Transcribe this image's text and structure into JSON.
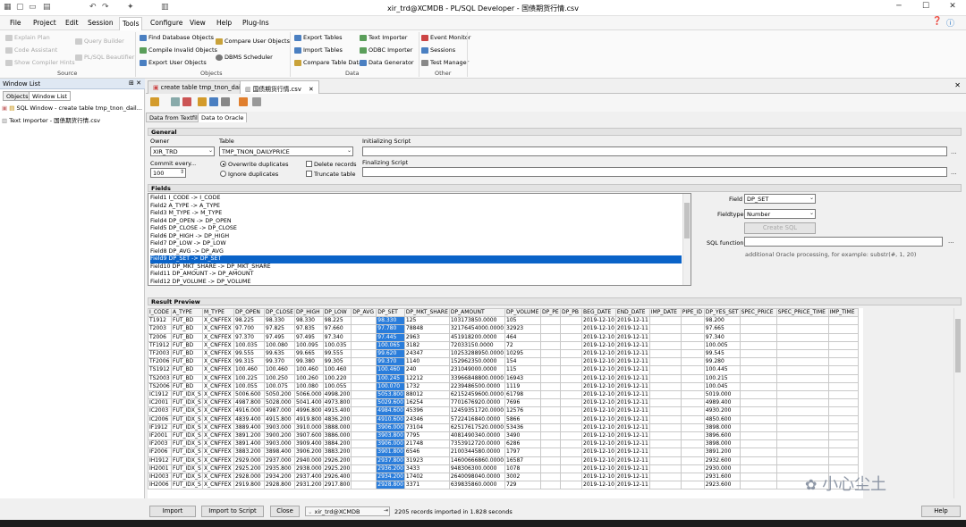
{
  "window": {
    "title": "xir_trd@XCMDB - PL/SQL Developer - 国债期货行情.csv"
  },
  "menu": [
    "File",
    "Project",
    "Edit",
    "Session",
    "Tools",
    "Configure",
    "View",
    "Help",
    "Plug-Ins"
  ],
  "ribbon": {
    "source": {
      "explain_plan": "Explain Plan",
      "code_assistant": "Code Assistant",
      "show_compiler_hints": "Show Compiler Hints",
      "query_builder": "Query Builder",
      "plsql_beautifier": "PL/SQL Beautifier",
      "group": "Source"
    },
    "objects": {
      "find_db_objects": "Find Database Objects",
      "compile_invalid": "Compile Invalid Objects",
      "export_user_objects": "Export User Objects",
      "compare_user_objects": "Compare User Objects",
      "dbms_scheduler": "DBMS Scheduler",
      "group": "Objects"
    },
    "data": {
      "export_tables": "Export Tables",
      "import_tables": "Import Tables",
      "compare_table_data": "Compare Table Data",
      "text_importer": "Text Importer",
      "odbc_importer": "ODBC Importer",
      "data_generator": "Data Generator",
      "group": "Data"
    },
    "other": {
      "event_monitor": "Event Monitor",
      "sessions": "Sessions",
      "test_manager": "Test Manager",
      "group": "Other"
    }
  },
  "left": {
    "title": "Window List",
    "tabs": [
      "Objects",
      "Window List"
    ],
    "items": [
      "SQL Window - create table tmp_tnon_dail...",
      "Text Importer - 国债期货行情.csv"
    ]
  },
  "doc_tabs": [
    "create table tmp_tnon_dail ...",
    "国债期货行情.csv"
  ],
  "sub_tabs": [
    "Data from Textfile",
    "Data to Oracle"
  ],
  "general": {
    "title": "General",
    "owner_label": "Owner",
    "owner_value": "XIR_TRD",
    "table_label": "Table",
    "table_value": "TMP_TNON_DAILYPRICE",
    "init_label": "Initializing Script",
    "final_label": "Finalizing Script",
    "commit_label": "Commit every...",
    "commit_value": "100",
    "overwrite": "Overwrite duplicates",
    "ignore": "Ignore duplicates",
    "delete_records": "Delete records",
    "truncate_table": "Truncate table"
  },
  "fields": {
    "title": "Fields",
    "items": [
      "Field1  I_CODE  ->  I_CODE",
      "Field2  A_TYPE  ->  A_TYPE",
      "Field3  M_TYPE  ->  M_TYPE",
      "Field4  DP_OPEN  ->  DP_OPEN",
      "Field5  DP_CLOSE  ->  DP_CLOSE",
      "Field6  DP_HIGH  ->  DP_HIGH",
      "Field7  DP_LOW  ->  DP_LOW",
      "Field8  DP_AVG  ->  DP_AVG",
      "Field9  DP_SET  ->  DP_SET",
      "Field10  DP_MKT_SHARE  ->  DP_MKT_SHARE",
      "Field11  DP_AMOUNT  ->  DP_AMOUNT",
      "Field12  DP_VOLUME  ->  DP_VOLUME"
    ],
    "field_label": "Field",
    "field_value": "DP_SET",
    "fieldtype_label": "Fieldtype",
    "fieldtype_value": "Number",
    "create_sql": "Create SQL",
    "sql_function_label": "SQL function",
    "hint": "additional Oracle processing, for example: substr(#, 1, 20)"
  },
  "preview": {
    "title": "Result Preview",
    "columns": [
      "I_CODE",
      "A_TYPE",
      "M_TYPE",
      "DP_OPEN",
      "DP_CLOSE",
      "DP_HIGH",
      "DP_LOW",
      "DP_AVG",
      "DP_SET",
      "DP_MKT_SHARE",
      "DP_AMOUNT",
      "DP_VOLUME",
      "DP_PE",
      "DP_PB",
      "BEG_DATE",
      "END_DATE",
      "IMP_DATE",
      "PIPE_ID",
      "DP_YES_SET",
      "SPEC_PRICE",
      "SPEC_PRICE_TIME",
      "IMP_TIME"
    ],
    "rows": [
      [
        "T1912",
        "FUT_BD",
        "X_CNFFEX",
        "98.225",
        "98.330",
        "98.330",
        "98.225",
        "",
        "98.330",
        "125",
        "103173850.0000",
        "105",
        "",
        "",
        "2019-12-10",
        "2019-12-11",
        "",
        "",
        "98.200",
        "",
        "",
        ""
      ],
      [
        "T2003",
        "FUT_BD",
        "X_CNFFEX",
        "97.700",
        "97.825",
        "97.835",
        "97.660",
        "",
        "97.780",
        "78848",
        "32176454000.0000",
        "32923",
        "",
        "",
        "2019-12-10",
        "2019-12-11",
        "",
        "",
        "97.665",
        "",
        "",
        ""
      ],
      [
        "T2006",
        "FUT_BD",
        "X_CNFFEX",
        "97.370",
        "97.495",
        "97.495",
        "97.340",
        "",
        "97.445",
        "2963",
        "451918200.0000",
        "464",
        "",
        "",
        "2019-12-10",
        "2019-12-11",
        "",
        "",
        "97.340",
        "",
        "",
        ""
      ],
      [
        "TF1912",
        "FUT_BD",
        "X_CNFFEX",
        "100.035",
        "100.080",
        "100.095",
        "100.035",
        "",
        "100.065",
        "3182",
        "72033150.0000",
        "72",
        "",
        "",
        "2019-12-10",
        "2019-12-11",
        "",
        "",
        "100.005",
        "",
        "",
        ""
      ],
      [
        "TF2003",
        "FUT_BD",
        "X_CNFFEX",
        "99.555",
        "99.635",
        "99.665",
        "99.555",
        "",
        "99.620",
        "24347",
        "10253288950.0000",
        "10295",
        "",
        "",
        "2019-12-10",
        "2019-12-11",
        "",
        "",
        "99.545",
        "",
        "",
        ""
      ],
      [
        "TF2006",
        "FUT_BD",
        "X_CNFFEX",
        "99.315",
        "99.370",
        "99.380",
        "99.305",
        "",
        "99.370",
        "1140",
        "152962350.0000",
        "154",
        "",
        "",
        "2019-12-10",
        "2019-12-11",
        "",
        "",
        "99.280",
        "",
        "",
        ""
      ],
      [
        "TS1912",
        "FUT_BD",
        "X_CNFFEX",
        "100.460",
        "100.460",
        "100.460",
        "100.460",
        "",
        "100.460",
        "240",
        "231049000.0000",
        "115",
        "",
        "",
        "2019-12-10",
        "2019-12-11",
        "",
        "",
        "100.445",
        "",
        "",
        ""
      ],
      [
        "TS2003",
        "FUT_BD",
        "X_CNFFEX",
        "100.225",
        "100.250",
        "100.260",
        "100.220",
        "",
        "100.245",
        "12212",
        "33966848800.0000",
        "16943",
        "",
        "",
        "2019-12-10",
        "2019-12-11",
        "",
        "",
        "100.215",
        "",
        "",
        ""
      ],
      [
        "TS2006",
        "FUT_BD",
        "X_CNFFEX",
        "100.055",
        "100.075",
        "100.080",
        "100.055",
        "",
        "100.070",
        "1732",
        "2239486500.0000",
        "1119",
        "",
        "",
        "2019-12-10",
        "2019-12-11",
        "",
        "",
        "100.045",
        "",
        "",
        ""
      ],
      [
        "IC1912",
        "FUT_IDX_S",
        "X_CNFFEX",
        "5006.600",
        "5050.200",
        "5066.000",
        "4998.200",
        "",
        "5053.800",
        "88012",
        "62152459600.0000",
        "61798",
        "",
        "",
        "2019-12-10",
        "2019-12-11",
        "",
        "",
        "5019.000",
        "",
        "",
        ""
      ],
      [
        "IC2001",
        "FUT_IDX_S",
        "X_CNFFEX",
        "4987.800",
        "5028.000",
        "5041.400",
        "4973.800",
        "",
        "5029.600",
        "16254",
        "7701676920.0000",
        "7696",
        "",
        "",
        "2019-12-10",
        "2019-12-11",
        "",
        "",
        "4989.400",
        "",
        "",
        ""
      ],
      [
        "IC2003",
        "FUT_IDX_S",
        "X_CNFFEX",
        "4916.000",
        "4987.000",
        "4996.800",
        "4915.400",
        "",
        "4984.600",
        "45396",
        "12459351720.0000",
        "12576",
        "",
        "",
        "2019-12-10",
        "2019-12-11",
        "",
        "",
        "4930.200",
        "",
        "",
        ""
      ],
      [
        "IC2006",
        "FUT_IDX_S",
        "X_CNFFEX",
        "4839.400",
        "4915.800",
        "4919.800",
        "4836.200",
        "",
        "4910.600",
        "24346",
        "5722416840.0000",
        "5866",
        "",
        "",
        "2019-12-10",
        "2019-12-11",
        "",
        "",
        "4850.600",
        "",
        "",
        ""
      ],
      [
        "IF1912",
        "FUT_IDX_S",
        "X_CNFFEX",
        "3889.400",
        "3903.000",
        "3910.000",
        "3888.000",
        "",
        "3906.000",
        "73104",
        "62517617520.0000",
        "53436",
        "",
        "",
        "2019-12-10",
        "2019-12-11",
        "",
        "",
        "3898.000",
        "",
        "",
        ""
      ],
      [
        "IF2001",
        "FUT_IDX_S",
        "X_CNFFEX",
        "3891.200",
        "3900.200",
        "3907.600",
        "3886.000",
        "",
        "3903.800",
        "7795",
        "4081490340.0000",
        "3490",
        "",
        "",
        "2019-12-10",
        "2019-12-11",
        "",
        "",
        "3896.600",
        "",
        "",
        ""
      ],
      [
        "IF2003",
        "FUT_IDX_S",
        "X_CNFFEX",
        "3891.400",
        "3903.000",
        "3909.400",
        "3884.200",
        "",
        "3906.000",
        "21748",
        "7353912720.0000",
        "6286",
        "",
        "",
        "2019-12-10",
        "2019-12-11",
        "",
        "",
        "3898.000",
        "",
        "",
        ""
      ],
      [
        "IF2006",
        "FUT_IDX_S",
        "X_CNFFEX",
        "3883.200",
        "3898.400",
        "3906.200",
        "3883.200",
        "",
        "3901.800",
        "6546",
        "2100344580.0000",
        "1797",
        "",
        "",
        "2019-12-10",
        "2019-12-11",
        "",
        "",
        "3891.200",
        "",
        "",
        ""
      ],
      [
        "IH1912",
        "FUT_IDX_S",
        "X_CNFFEX",
        "2929.000",
        "2937.000",
        "2940.000",
        "2926.200",
        "",
        "2937.800",
        "31923",
        "14600666860.0000",
        "16587",
        "",
        "",
        "2019-12-10",
        "2019-12-11",
        "",
        "",
        "2932.600",
        "",
        "",
        ""
      ],
      [
        "IH2001",
        "FUT_IDX_S",
        "X_CNFFEX",
        "2925.200",
        "2935.800",
        "2938.000",
        "2925.200",
        "",
        "2936.200",
        "3433",
        "948306300.0000",
        "1078",
        "",
        "",
        "2019-12-10",
        "2019-12-11",
        "",
        "",
        "2930.000",
        "",
        "",
        ""
      ],
      [
        "IH2003",
        "FUT_IDX_S",
        "X_CNFFEX",
        "2928.000",
        "2934.200",
        "2937.400",
        "2926.400",
        "",
        "2934.200",
        "17402",
        "2640098040.0000",
        "3002",
        "",
        "",
        "2019-12-10",
        "2019-12-11",
        "",
        "",
        "2931.600",
        "",
        "",
        ""
      ],
      [
        "IH2006",
        "FUT_IDX_S",
        "X_CNFFEX",
        "2919.800",
        "2928.800",
        "2931.200",
        "2917.800",
        "",
        "2928.800",
        "3371",
        "639835860.0000",
        "729",
        "",
        "",
        "2019-12-10",
        "2019-12-11",
        "",
        "",
        "2923.600",
        "",
        "",
        ""
      ]
    ]
  },
  "status": {
    "import": "Import",
    "import_script": "Import to Script",
    "close": "Close",
    "connection": "xir_trd@XCMDB",
    "message": "2205 records imported in 1.828 seconds",
    "help": "Help"
  },
  "watermark": "小心尘土"
}
